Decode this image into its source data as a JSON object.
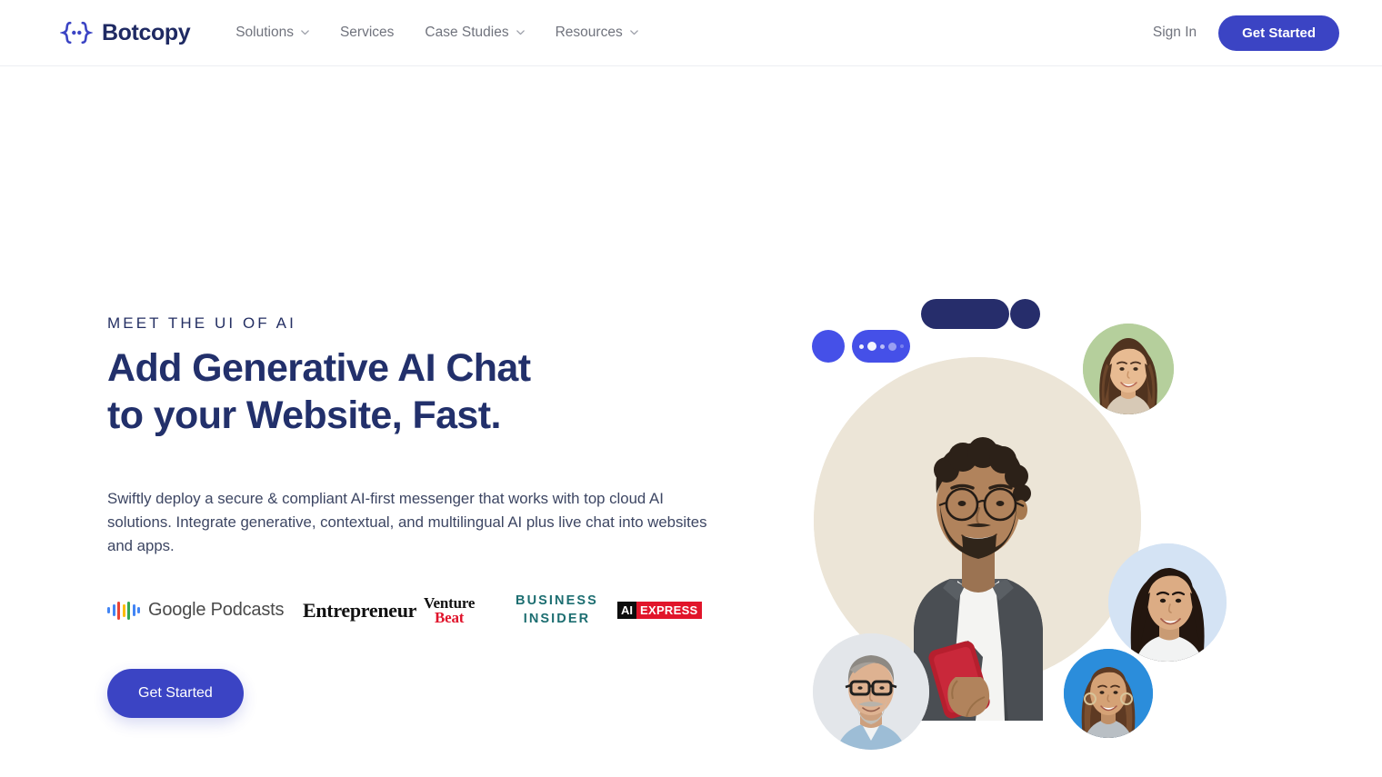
{
  "header": {
    "brand": {
      "logo_icon": "braces-dots-icon",
      "name": "Botcopy",
      "logo_color": "#3b44c4",
      "name_color": "#1f2a63"
    },
    "nav": [
      {
        "label": "Solutions",
        "has_dropdown": true,
        "icon": "chevron-down-icon"
      },
      {
        "label": "Services",
        "has_dropdown": false,
        "icon": ""
      },
      {
        "label": "Case Studies",
        "has_dropdown": true,
        "icon": "chevron-down-icon"
      },
      {
        "label": "Resources",
        "has_dropdown": true,
        "icon": "chevron-down-icon"
      }
    ],
    "sign_in_label": "Sign In",
    "get_started_label": "Get Started",
    "accent_color": "#3b44c4"
  },
  "hero": {
    "eyebrow": "MEET THE UI OF AI",
    "title_line1": "Add Generative AI Chat",
    "title_line2": "to your Website, Fast.",
    "description": "Swiftly deploy a secure & compliant AI-first messenger that works with top cloud AI solutions. Integrate generative, contextual, and multilingual AI plus live chat into websites and apps.",
    "cta_label": "Get Started",
    "title_color": "#22306b",
    "press": [
      {
        "id": "google-podcasts",
        "name": "Google Podcasts",
        "text": "Google Podcasts",
        "colors": [
          "#4285f4",
          "#ea4335",
          "#fbbc04",
          "#34a853"
        ]
      },
      {
        "id": "entrepreneur",
        "name": "Entrepreneur",
        "text": "Entrepreneur"
      },
      {
        "id": "venturebeat",
        "name": "VentureBeat",
        "text_top": "Venture",
        "text_bottom": "Beat",
        "accent": "#e0132b"
      },
      {
        "id": "business-insider",
        "name": "Business Insider",
        "text_top": "BUSINESS",
        "text_bottom": "INSIDER",
        "accent": "#1d6e71"
      },
      {
        "id": "ai-express",
        "name": "AI Express",
        "text_badge": "AI",
        "text_main": "EXPRESS",
        "accent": "#e1152a"
      }
    ],
    "art": {
      "bubbles": [
        {
          "id": "navy-pill",
          "shape": "pill",
          "color": "#262d6b"
        },
        {
          "id": "navy-dot",
          "shape": "circle",
          "color": "#262d6b"
        },
        {
          "id": "blue-dot",
          "shape": "circle",
          "color": "#4550e8"
        },
        {
          "id": "typing-pill",
          "shape": "pill",
          "color": "#4550e8",
          "dots": 5
        }
      ],
      "main_photo": {
        "alt": "Man with glasses smiling holding a red phone",
        "backdrop": "#ece5d7"
      },
      "avatars": [
        {
          "id": "avatar-green",
          "alt": "Smiling woman with long brown hair",
          "backdrop": "#b5cf9c"
        },
        {
          "id": "avatar-light-blue",
          "alt": "Smiling woman with dark hair",
          "backdrop": "#d4e3f4"
        },
        {
          "id": "avatar-gray",
          "alt": "Older man with glasses and beard",
          "backdrop": "#e3e6ea"
        },
        {
          "id": "avatar-blue",
          "alt": "Smiling woman with hoop earrings",
          "backdrop": "#2b8ddb"
        }
      ]
    }
  }
}
